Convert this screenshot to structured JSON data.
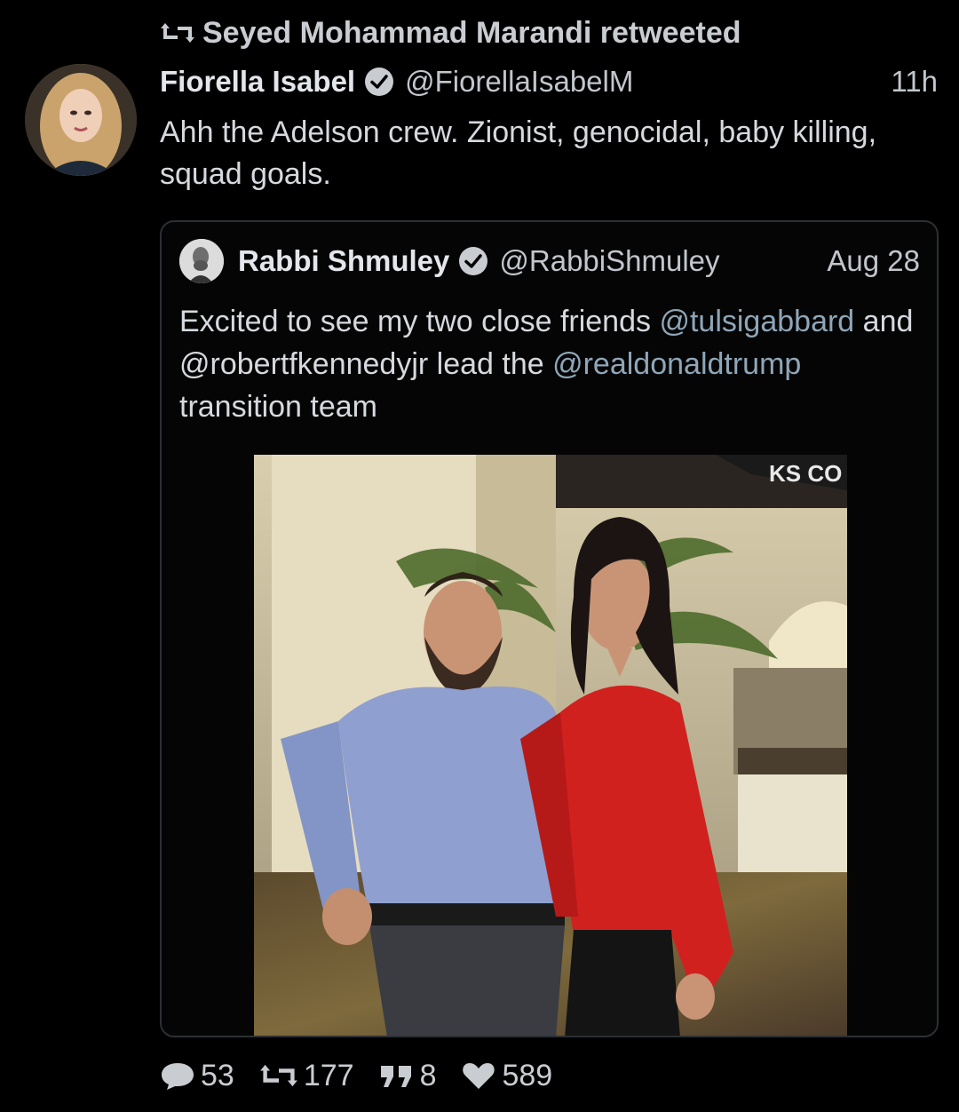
{
  "retweet_banner": {
    "icon": "retweet-icon",
    "text": "Seyed Mohammad Marandi retweeted"
  },
  "tweet": {
    "author_name": "Fiorella Isabel",
    "handle": "@FiorellaIsabelM",
    "time": "11h",
    "text": "Ahh the Adelson crew. Zionist, genocidal, baby killing, squad goals."
  },
  "quoted_tweet": {
    "author_name": "Rabbi Shmuley",
    "handle": "@RabbiShmuley",
    "date": "Aug 28",
    "text_parts": [
      "Excited to see my two close friends ",
      "@tulsigabbard",
      " and ",
      "@robertfkennedyjr",
      " lead the ",
      "@realdonaldtrump",
      " transition team"
    ],
    "photo_sign_text": "KS CO"
  },
  "actions": {
    "replies": "53",
    "retweets": "177",
    "quotes": "8",
    "likes": "589"
  },
  "colors": {
    "background": "#000000",
    "mention": "#8fa6b8",
    "verified": "#c9ccd1"
  }
}
